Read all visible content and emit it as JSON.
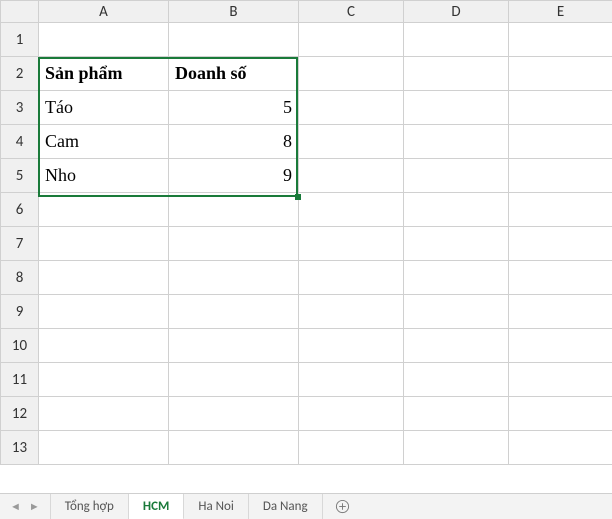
{
  "columns": [
    "A",
    "B",
    "C",
    "D",
    "E"
  ],
  "rows": [
    "1",
    "2",
    "3",
    "4",
    "5",
    "6",
    "7",
    "8",
    "9",
    "10",
    "11",
    "12",
    "13"
  ],
  "cells": {
    "A2": "Sản phẩm",
    "B2": "Doanh số",
    "A3": "Táo",
    "B3": "5",
    "A4": "Cam",
    "B4": "8",
    "A5": "Nho",
    "B5": "9"
  },
  "tabs": {
    "items": [
      "Tổng hợp",
      "HCM",
      "Ha Noi",
      "Da Nang"
    ],
    "active": "HCM"
  },
  "chart_data": {
    "type": "table",
    "headers": [
      "Sản phẩm",
      "Doanh số"
    ],
    "rows": [
      [
        "Táo",
        5
      ],
      [
        "Cam",
        8
      ],
      [
        "Nho",
        9
      ]
    ]
  }
}
